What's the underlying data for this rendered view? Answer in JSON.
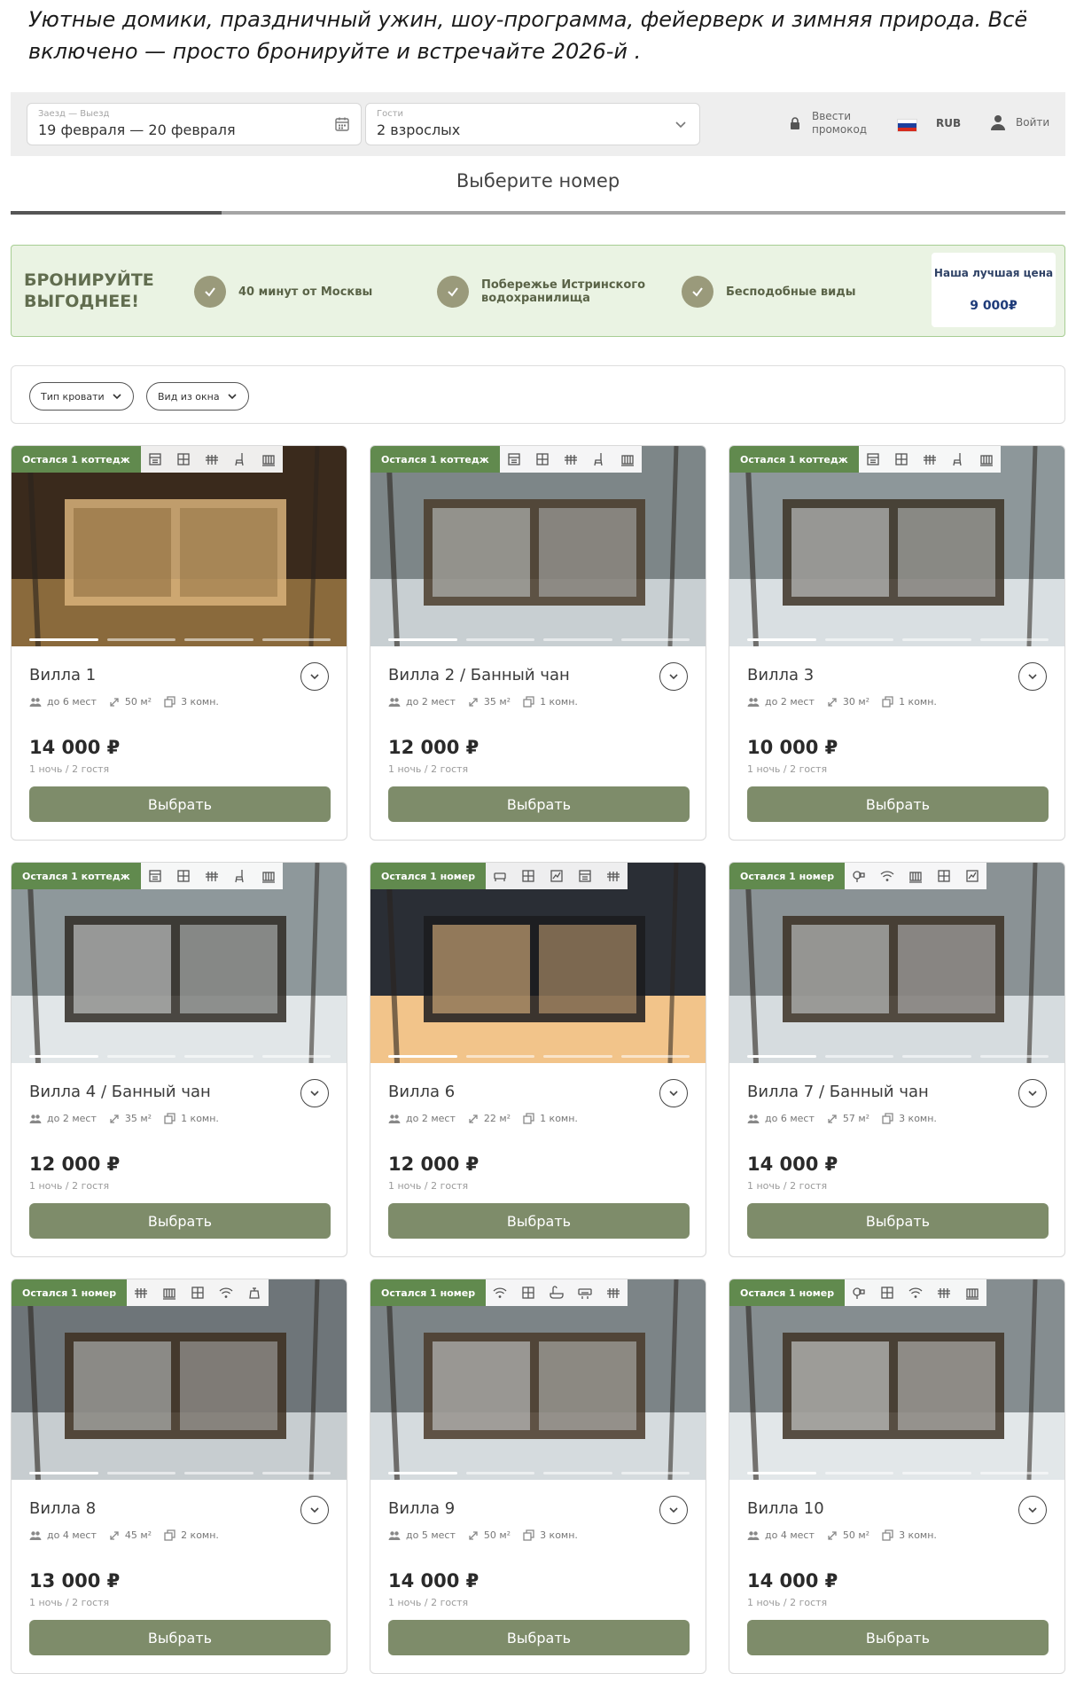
{
  "intro_text": "Уютные домики, праздничный ужин, шоу-программа, фейерверк и зимняя природа. Всё включено — просто бронируйте и встречайте 2026-й .",
  "search": {
    "dates_label": "Заезд — Выезд",
    "dates_value": "19 февраля — 20 февраля",
    "guests_label": "Гости",
    "guests_value": "2 взрослых",
    "promo_label": "Ввести промокод",
    "currency": "RUB",
    "login_label": "Войти"
  },
  "step": {
    "title": "Выберите номер",
    "progress": 0.2
  },
  "banner": {
    "title": "БРОНИРУЙТЕ ВЫГОДНЕЕ!",
    "benefits": [
      "40 минут от Москвы",
      "Побережье Истринского водохранилища",
      "Бесподобные виды"
    ],
    "best_price_label": "Наша лучшая цена",
    "best_price_value": "9 000₽"
  },
  "filters": {
    "bed_type": "Тип кровати",
    "window_view": "Вид из окна"
  },
  "cards": [
    {
      "badge": "Остался 1 коттедж",
      "name": "Вилла 1",
      "guests": "до 6 мест",
      "area": "50 м²",
      "rooms": "3 комн.",
      "price": "14 000 ₽",
      "per": "1 ночь / 2 гостя",
      "button": "Выбрать",
      "amenities": [
        "stove-icon",
        "window-icon",
        "heater-icon",
        "chair-icon",
        "radiator-icon"
      ]
    },
    {
      "badge": "Остался 1 коттедж",
      "name": "Вилла 2 / Банный чан",
      "guests": "до 2 мест",
      "area": "35 м²",
      "rooms": "1 комн.",
      "price": "12 000 ₽",
      "per": "1 ночь / 2 гостя",
      "button": "Выбрать",
      "amenities": [
        "stove-icon",
        "window-icon",
        "heater-icon",
        "chair-icon",
        "radiator-icon"
      ]
    },
    {
      "badge": "Остался 1 коттедж",
      "name": "Вилла 3",
      "guests": "до 2 мест",
      "area": "30 м²",
      "rooms": "1 комн.",
      "price": "10 000 ₽",
      "per": "1 ночь / 2 гостя",
      "button": "Выбрать",
      "amenities": [
        "stove-icon",
        "window-icon",
        "heater-icon",
        "chair-icon",
        "radiator-icon"
      ]
    },
    {
      "badge": "Остался 1 коттедж",
      "name": "Вилла 4 / Банный чан",
      "guests": "до 2 мест",
      "area": "35 м²",
      "rooms": "1 комн.",
      "price": "12 000 ₽",
      "per": "1 ночь / 2 гостя",
      "button": "Выбрать",
      "amenities": [
        "stove-icon",
        "window-icon",
        "heater-icon",
        "chair-icon",
        "radiator-icon"
      ]
    },
    {
      "badge": "Остался 1 номер",
      "name": "Вилла 6",
      "guests": "до 2 мест",
      "area": "22 м²",
      "rooms": "1 комн.",
      "price": "12 000 ₽",
      "per": "1 ночь / 2 гостя",
      "button": "Выбрать",
      "amenities": [
        "sofa-icon",
        "window-icon",
        "view-icon",
        "stove-icon",
        "heater-icon"
      ]
    },
    {
      "badge": "Остался 1 номер",
      "name": "Вилла 7 / Банный чан",
      "guests": "до 6 мест",
      "area": "57 м²",
      "rooms": "3 комн.",
      "price": "14 000 ₽",
      "per": "1 ночь / 2 гостя",
      "button": "Выбрать",
      "amenities": [
        "hairdryer-icon",
        "wifi-icon",
        "radiator-icon",
        "window-icon",
        "view-icon"
      ]
    },
    {
      "badge": "Остался 1 номер",
      "name": "Вилла 8",
      "guests": "до 4 мест",
      "area": "45 м²",
      "rooms": "2 комн.",
      "price": "13 000 ₽",
      "per": "1 ночь / 2 гостя",
      "button": "Выбрать",
      "amenities": [
        "heater-icon",
        "radiator-icon",
        "window-icon",
        "wifi-icon",
        "kettle-icon"
      ]
    },
    {
      "badge": "Остался 1 номер",
      "name": "Вилла 9",
      "guests": "до 5 мест",
      "area": "50 м²",
      "rooms": "3 комн.",
      "price": "14 000 ₽",
      "per": "1 ночь / 2 гостя",
      "button": "Выбрать",
      "amenities": [
        "wifi-icon",
        "window-icon",
        "bath-icon",
        "aircon-icon",
        "heater-icon"
      ]
    },
    {
      "badge": "Остался 1 номер",
      "name": "Вилла 10",
      "guests": "до 4 мест",
      "area": "50 м²",
      "rooms": "3 комн.",
      "price": "14 000 ₽",
      "per": "1 ночь / 2 гостя",
      "button": "Выбрать",
      "amenities": [
        "hairdryer-icon",
        "window-icon",
        "wifi-icon",
        "heater-icon",
        "radiator-icon"
      ]
    }
  ],
  "colors": {
    "accent": "#618a4e",
    "button": "#7e8c6a",
    "banner_bg": "#eaf3e3"
  }
}
